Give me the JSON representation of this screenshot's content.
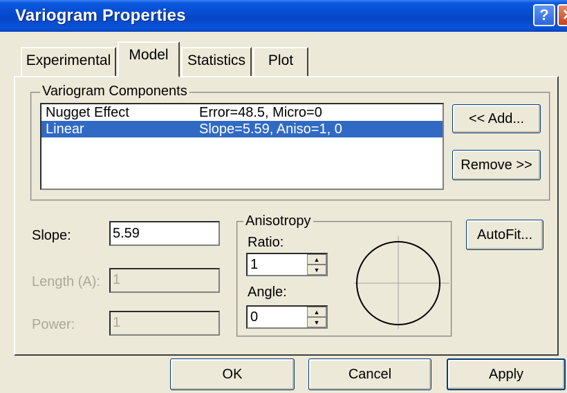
{
  "window": {
    "title": "Variogram Properties"
  },
  "tabs": [
    {
      "label": "Experimental"
    },
    {
      "label": "Model"
    },
    {
      "label": "Statistics"
    },
    {
      "label": "Plot"
    }
  ],
  "active_tab": "Model",
  "components": {
    "group_label": "Variogram Components",
    "rows": [
      {
        "name": "Nugget Effect",
        "params": "Error=48.5, Micro=0",
        "selected": false
      },
      {
        "name": "Linear",
        "params": "Slope=5.59, Aniso=1, 0",
        "selected": true
      }
    ],
    "add_label": "<< Add...",
    "remove_label": "Remove >>"
  },
  "params": {
    "slope_label": "Slope:",
    "slope_value": "5.59",
    "length_label": "Length (A):",
    "length_value": "1",
    "power_label": "Power:",
    "power_value": "1"
  },
  "anisotropy": {
    "group_label": "Anisotropy",
    "ratio_label": "Ratio:",
    "ratio_value": "1",
    "angle_label": "Angle:",
    "angle_value": "0"
  },
  "autofit_label": "AutoFit...",
  "footer": {
    "ok_label": "OK",
    "cancel_label": "Cancel",
    "apply_label": "Apply"
  },
  "icons": {
    "help": "help-icon",
    "close": "close-icon",
    "spin_up": "spin-up-icon",
    "spin_down": "spin-down-icon"
  },
  "colors": {
    "titlebar": "#0646c8",
    "selection": "#316ac5",
    "dialog_bg": "#ece9d8"
  }
}
